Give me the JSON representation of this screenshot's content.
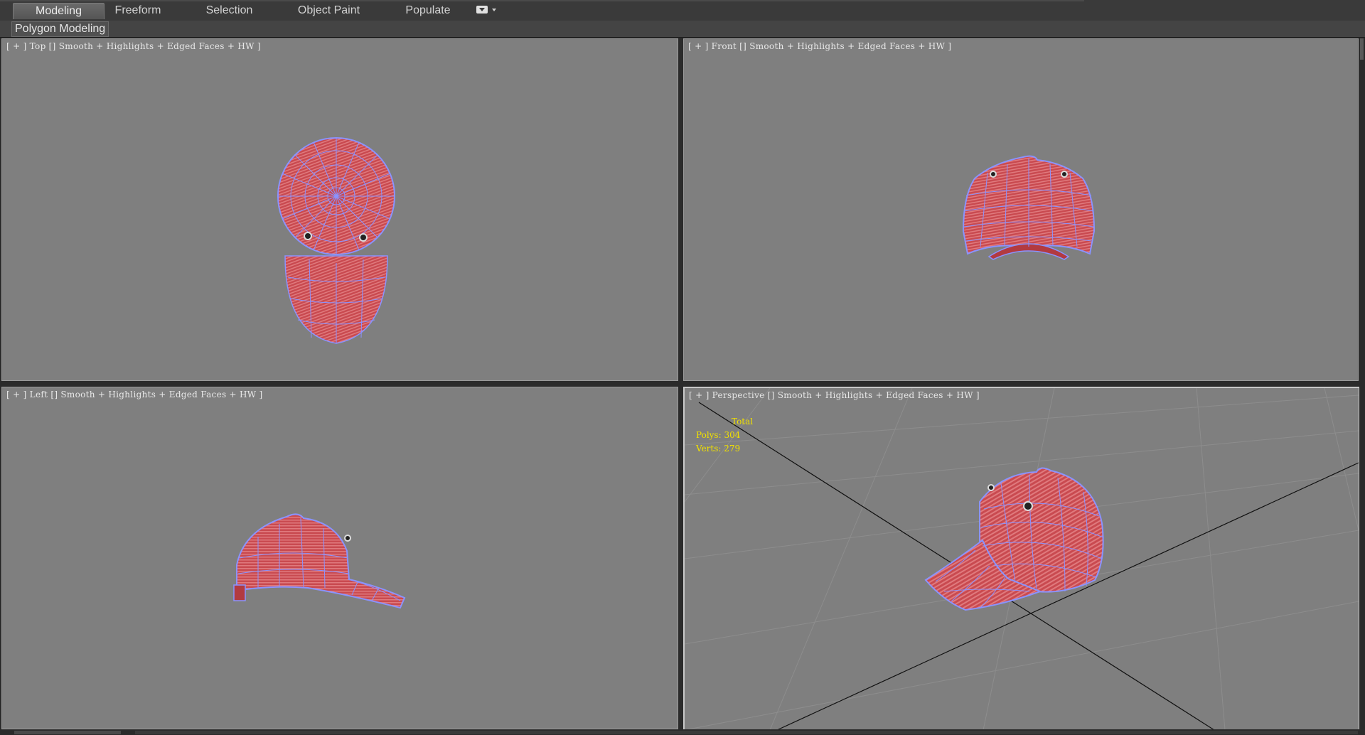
{
  "ribbon": {
    "tabs": [
      "Modeling",
      "Freeform",
      "Selection",
      "Object Paint",
      "Populate"
    ],
    "active_tab": "Modeling",
    "sub_label": "Polygon Modeling"
  },
  "viewports": {
    "top": {
      "label_brackets_open": "[ + ] ",
      "view": "Top",
      "mode": " [] Smooth + Highlights + Edged Faces + HW ]"
    },
    "front": {
      "label_brackets_open": "[ + ] ",
      "view": "Front",
      "mode": " [] Smooth + Highlights + Edged Faces + HW ]"
    },
    "left": {
      "label_brackets_open": "[ + ] ",
      "view": "Left",
      "mode": " [] Smooth + Highlights + Edged Faces + HW ]"
    },
    "perspective": {
      "label_brackets_open": "[ + ] ",
      "view": "Perspective",
      "mode": " [] Smooth + Highlights + Edged Faces + HW ]"
    }
  },
  "stats": {
    "total": "Total",
    "polys": "Polys: 304",
    "verts": "Verts: 279"
  },
  "colors": {
    "viewport_bg": "#7f7f7f",
    "cap_red": "#c8474d",
    "wire_blue": "#8a93ff",
    "stats_yellow": "#f0e000"
  },
  "icons": {
    "ribbon_extra": "ribbon-options-icon"
  }
}
